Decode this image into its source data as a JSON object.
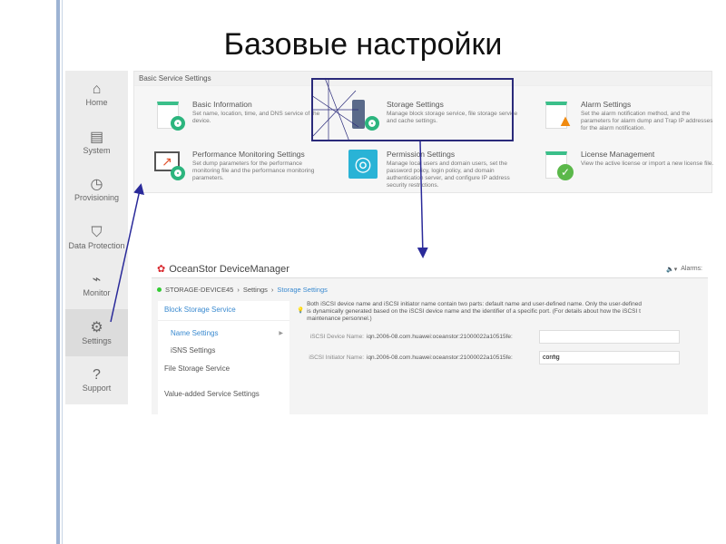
{
  "slide_title": "Базовые настройки",
  "sidebar": {
    "items": [
      {
        "label": "Home",
        "icon": "home-icon",
        "glyph": "⌂"
      },
      {
        "label": "System",
        "icon": "system-icon",
        "glyph": "▤"
      },
      {
        "label": "Provisioning",
        "icon": "provisioning-icon",
        "glyph": "◷"
      },
      {
        "label": "Data Protection",
        "icon": "shield-icon",
        "glyph": "⛉"
      },
      {
        "label": "Monitor",
        "icon": "monitor-icon",
        "glyph": "⌁"
      },
      {
        "label": "Settings",
        "icon": "gear-icon",
        "glyph": "⚙",
        "active": true
      },
      {
        "label": "Support",
        "icon": "help-icon",
        "glyph": "?"
      }
    ]
  },
  "panel": {
    "title": "Basic Service Settings",
    "cards": [
      {
        "title": "Basic Information",
        "desc": "Set name, location, time, and DNS service of the device."
      },
      {
        "title": "Storage Settings",
        "desc": "Manage block storage service, file storage service and cache settings."
      },
      {
        "title": "Alarm Settings",
        "desc": "Set the alarm notification method, and the parameters for alarm dump and Trap IP addresses for the alarm notification."
      },
      {
        "title": "Performance Monitoring Settings",
        "desc": "Set dump parameters for the performance monitoring file and the performance monitoring parameters."
      },
      {
        "title": "Permission Settings",
        "desc": "Manage local users and domain users, set the password policy, login policy, and domain authentication server, and configure IP address security restrictions."
      },
      {
        "title": "License Management",
        "desc": "View the active license or import a new license file."
      }
    ]
  },
  "window": {
    "app_title": "OceanStor DeviceManager",
    "alarms_label": "Alarms:",
    "breadcrumb": [
      "STORAGE-DEVICE45",
      "Settings",
      "Storage Settings"
    ],
    "nav": {
      "block": "Block Storage Service",
      "name_settings": "Name Settings",
      "isns": "iSNS Settings",
      "file": "File Storage Service",
      "value_added": "Value-added Service Settings"
    },
    "tip": [
      "Both iSCSI device name and iSCSI initiator name contain two parts: default name and user-defined name. Only the user-defined",
      "is dynamically generated based on the iSCSI device name and the identifier of a specific port. (For details about how the iSCSI t",
      "maintenance personnel.)"
    ],
    "fields": [
      {
        "label": "iSCSI Device Name:",
        "prefix": "iqn.2006-08.com.huawei:oceanstor:21000022a10515fe:",
        "value": ""
      },
      {
        "label": "iSCSI Initiator Name:",
        "prefix": "iqn.2006-08.com.huawei:oceanstor:21000022a10515fe:",
        "value": "config"
      }
    ]
  },
  "colors": {
    "accent": "#3a8ad0",
    "green": "#2cb57e",
    "arrow": "#2a2a9a"
  }
}
